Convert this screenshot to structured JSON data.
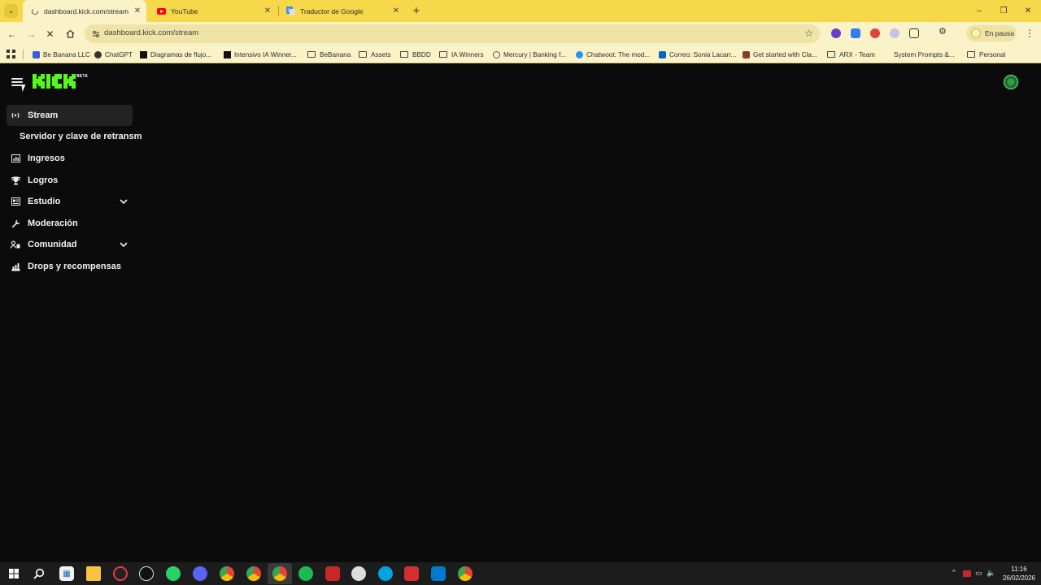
{
  "browser": {
    "tabs": [
      {
        "title": "dashboard.kick.com/stream",
        "icon": "loading-favicon-icon"
      },
      {
        "title": "YouTube",
        "icon": "youtube-icon"
      },
      {
        "title": "Traductor de Google",
        "icon": "google-translate-icon"
      }
    ],
    "url": "dashboard.kick.com/stream",
    "profile_status": "En pausa",
    "bookmarks": [
      {
        "label": "Be Banana LLC",
        "icon": "bookmark-site-icon"
      },
      {
        "label": "ChatGPT",
        "icon": "chatgpt-icon"
      },
      {
        "label": "Diagramas de flujo...",
        "icon": "bookmark-site-icon"
      },
      {
        "label": "Intensivo IA Winner...",
        "icon": "bookmark-site-icon"
      },
      {
        "label": "BeBanana",
        "icon": "folder-icon"
      },
      {
        "label": "Assets",
        "icon": "folder-icon"
      },
      {
        "label": "BBDD",
        "icon": "folder-icon"
      },
      {
        "label": "IA Winners",
        "icon": "folder-icon"
      },
      {
        "label": "Mercury | Banking f...",
        "icon": "globe-icon"
      },
      {
        "label": "Chatwoot: The mod...",
        "icon": "chatwoot-icon"
      },
      {
        "label": "Correo: Sonia Lacarr...",
        "icon": "outlook-icon"
      },
      {
        "label": "Get started with Cla...",
        "icon": "bookmark-site-icon"
      },
      {
        "label": "ARX - Team",
        "icon": "folder-icon"
      },
      {
        "label": "System Prompts &...",
        "icon": "bookmark-site-icon"
      },
      {
        "label": "Personal",
        "icon": "folder-icon"
      }
    ]
  },
  "app": {
    "logo_text": "KICK",
    "logo_badge": "BETA",
    "brand_color": "#53fc18",
    "sidebar": {
      "items": [
        {
          "label": "Stream",
          "icon": "broadcast-icon",
          "active": true
        },
        {
          "label": "Servidor y clave de retransmisión",
          "sub": true
        },
        {
          "label": "Ingresos",
          "icon": "chart-icon"
        },
        {
          "label": "Logros",
          "icon": "trophy-icon"
        },
        {
          "label": "Estudio",
          "icon": "studio-icon",
          "expandable": true
        },
        {
          "label": "Moderación",
          "icon": "wrench-icon"
        },
        {
          "label": "Comunidad",
          "icon": "community-icon",
          "expandable": true
        },
        {
          "label": "Drops y recompensas",
          "icon": "drops-icon"
        }
      ]
    }
  },
  "taskbar": {
    "time": "11:16",
    "date": "26/02/2026"
  }
}
